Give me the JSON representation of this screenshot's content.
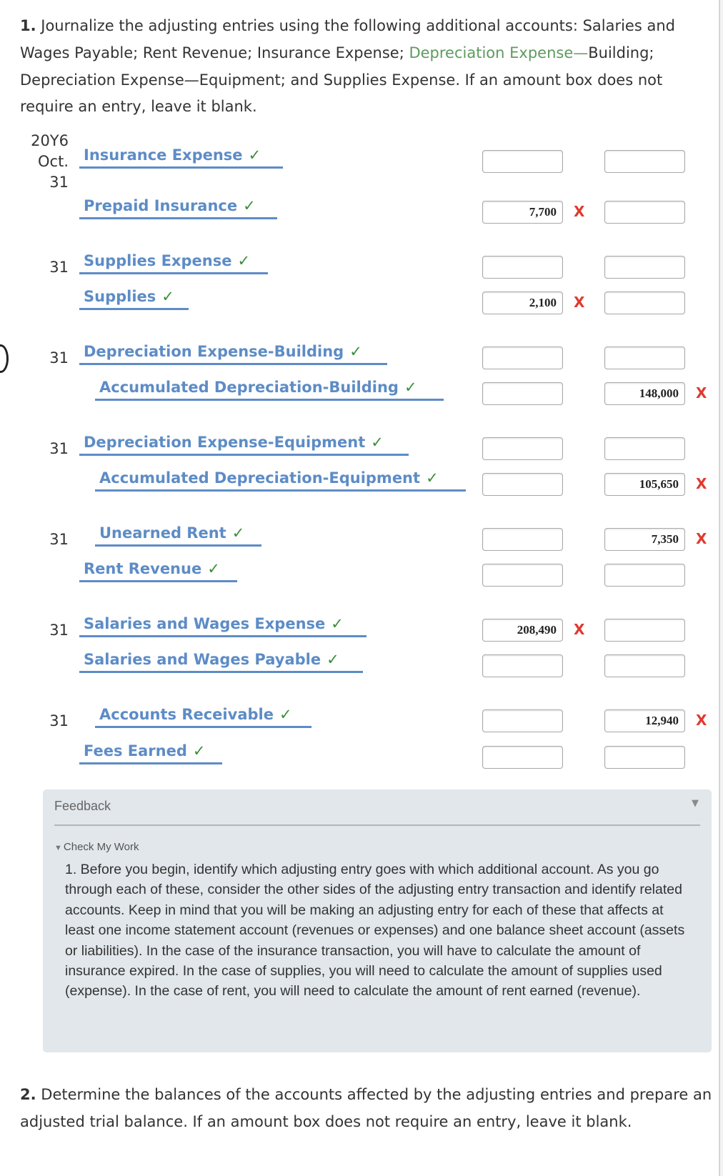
{
  "part1": {
    "number": "1.",
    "text_before": " Journalize the adjusting entries using the following additional accounts: Salaries and Wages Payable; Rent Revenue; Insurance Expense; ",
    "highlight": "Depreciation Expense—",
    "text_after": "Building; Depreciation Expense—Equipment; and Supplies Expense. If an amount box does not require an entry, leave it blank."
  },
  "journal": {
    "year": "20Y6",
    "month": "Oct.",
    "check_icon": "✓",
    "x_icon": "X",
    "entries": [
      {
        "day": "31",
        "debit_account": "Insurance Expense",
        "credit_account": "Prepaid Insurance",
        "debit_line": {
          "debit": "",
          "credit": ""
        },
        "credit_line": {
          "debit": "7,700",
          "debit_status": "incorrect",
          "credit": ""
        }
      },
      {
        "day": "31",
        "debit_account": "Supplies Expense",
        "credit_account": "Supplies",
        "debit_line": {
          "debit": "",
          "credit": ""
        },
        "credit_line": {
          "debit": "2,100",
          "debit_status": "incorrect",
          "credit": ""
        }
      },
      {
        "day": "31",
        "debit_account": "Depreciation Expense-Building",
        "credit_account": "Accumulated Depreciation-Building",
        "debit_line": {
          "debit": "",
          "credit": ""
        },
        "credit_line": {
          "debit": "",
          "credit": "148,000",
          "credit_status": "incorrect"
        }
      },
      {
        "day": "31",
        "debit_account": "Depreciation Expense-Equipment",
        "credit_account": "Accumulated Depreciation-Equipment",
        "debit_line": {
          "debit": "",
          "credit": ""
        },
        "credit_line": {
          "debit": "",
          "credit": "105,650",
          "credit_status": "incorrect"
        }
      },
      {
        "day": "31",
        "debit_account": "Unearned Rent",
        "credit_account": "Rent Revenue",
        "debit_line": {
          "debit": "",
          "credit": "7,350",
          "credit_status": "incorrect"
        },
        "credit_line": {
          "debit": "",
          "credit": ""
        }
      },
      {
        "day": "31",
        "debit_account": "Salaries and Wages Expense",
        "credit_account": "Salaries and Wages Payable",
        "debit_line": {
          "debit": "208,490",
          "debit_status": "incorrect",
          "credit": ""
        },
        "credit_line": {
          "debit": "",
          "credit": ""
        }
      },
      {
        "day": "31",
        "debit_account": "Accounts Receivable",
        "credit_account": "Fees Earned",
        "debit_line": {
          "debit": "",
          "credit": "12,940",
          "credit_status": "incorrect"
        },
        "credit_line": {
          "debit": "",
          "credit": ""
        }
      }
    ]
  },
  "feedback": {
    "title": "Feedback",
    "toggle_icon": "▼",
    "check_my_work": "Check My Work",
    "text": "1. Before you begin, identify which adjusting entry goes with which additional account. As you go through each of these, consider the other sides of the adjusting entry transaction and identify related accounts. Keep in mind that you will be making an adjusting entry for each of these that affects at least one income statement account (revenues or expenses) and one balance sheet account (assets or liabilities). In the case of the insurance transaction, you will have to calculate the amount of insurance expired. In the case of supplies, you will need to calculate the amount of supplies used (expense). In the case of rent, you will need to calculate the amount of rent earned (revenue)."
  },
  "part2": {
    "number": "2.",
    "text": " Determine the balances of the accounts affected by the adjusting entries and prepare an adjusted trial balance. If an amount box does not require an entry, leave it blank."
  }
}
